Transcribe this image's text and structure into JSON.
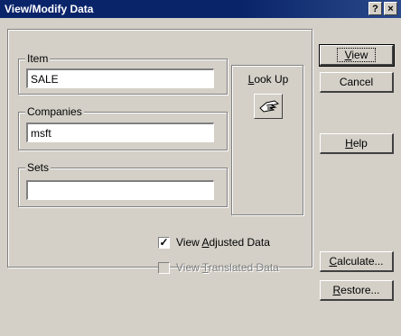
{
  "dialog": {
    "title": "View/Modify Data",
    "help_button": "?",
    "close_button": "×"
  },
  "item_group": {
    "label": "Item",
    "value": "SALE"
  },
  "companies_group": {
    "label": "Companies",
    "value": "msft"
  },
  "sets_group": {
    "label": "Sets",
    "value": ""
  },
  "lookup": {
    "label_prefix": "",
    "label_underlined": "L",
    "label_rest": "ook Up",
    "icon": "lookup-hand-icon"
  },
  "checks": {
    "adjusted": {
      "pre": "View ",
      "u": "A",
      "post": "djusted Data",
      "checked": true
    },
    "translated": {
      "pre": "View ",
      "u": "T",
      "post": "ranslated Data",
      "checked": false,
      "disabled": true
    }
  },
  "buttons": {
    "view": {
      "u": "V",
      "rest": "iew"
    },
    "cancel": "Cancel",
    "help": {
      "u": "H",
      "rest": "elp"
    },
    "calculate": {
      "u": "C",
      "rest": "alculate..."
    },
    "restore": {
      "u": "R",
      "rest": "estore..."
    }
  }
}
